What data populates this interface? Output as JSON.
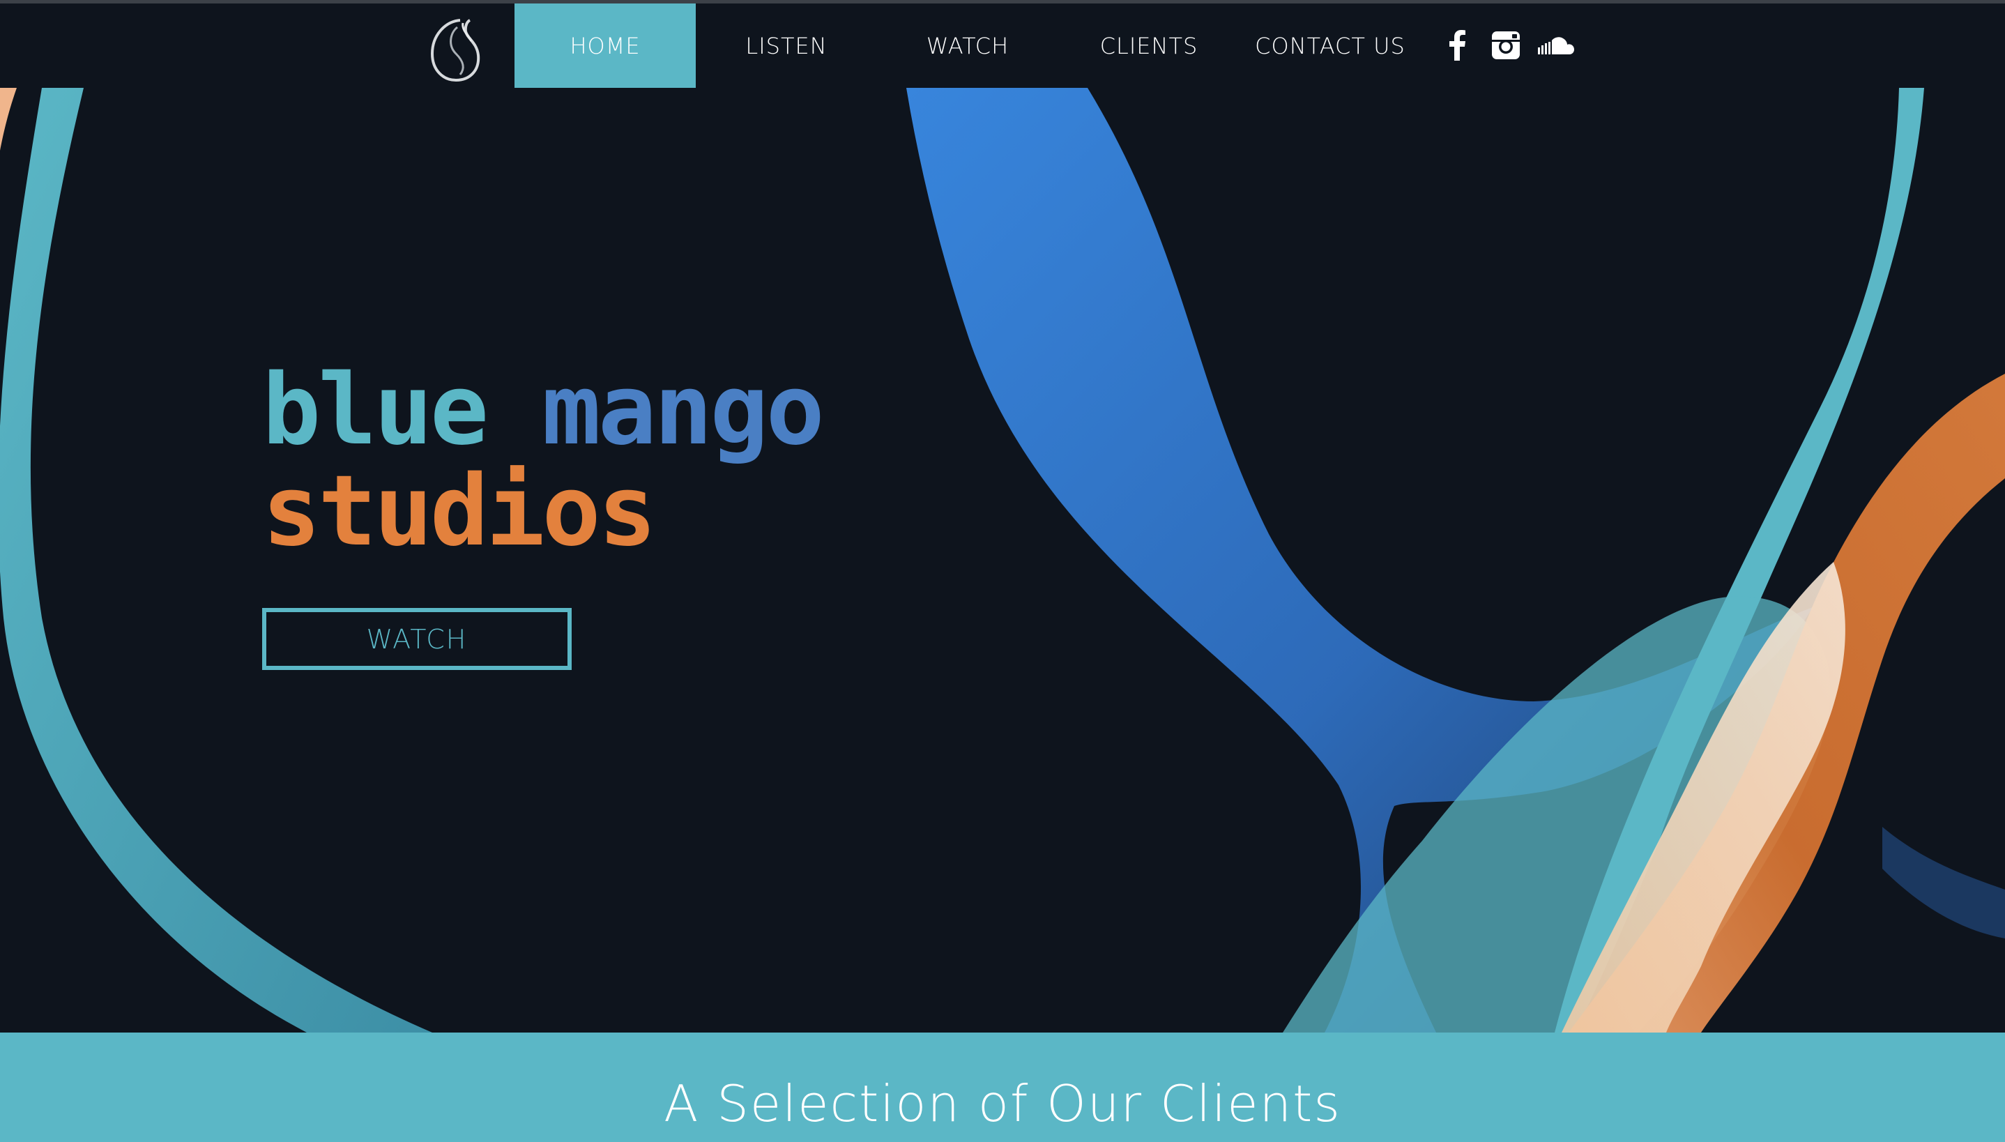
{
  "nav": {
    "items": [
      {
        "label": "HOME",
        "active": true
      },
      {
        "label": "LISTEN",
        "active": false
      },
      {
        "label": "WATCH",
        "active": false
      },
      {
        "label": "CLIENTS",
        "active": false
      },
      {
        "label": "CONTACT US",
        "active": false
      }
    ],
    "social": [
      "facebook-icon",
      "instagram-icon",
      "soundcloud-icon"
    ]
  },
  "hero": {
    "title_word1": "blue",
    "title_word2": "mango",
    "title_word3": "studios",
    "watch_button": "WATCH"
  },
  "clients": {
    "heading": "A Selection of Our Clients"
  },
  "colors": {
    "background": "#0e141d",
    "teal": "#5bb7c6",
    "blue": "#4a7fc4",
    "orange": "#e3813d"
  }
}
